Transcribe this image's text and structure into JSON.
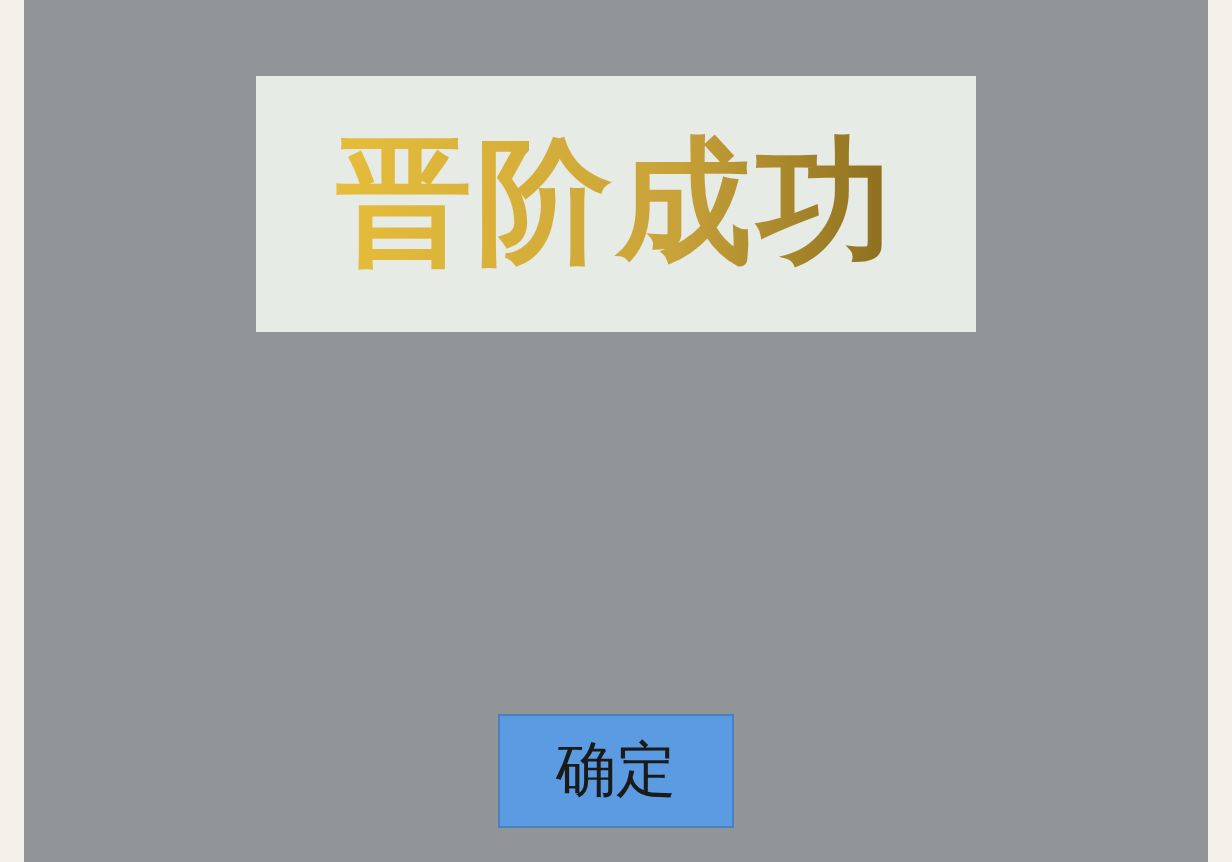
{
  "banner": {
    "title": "晋阶成功"
  },
  "confirm_button": {
    "label": "确定"
  }
}
